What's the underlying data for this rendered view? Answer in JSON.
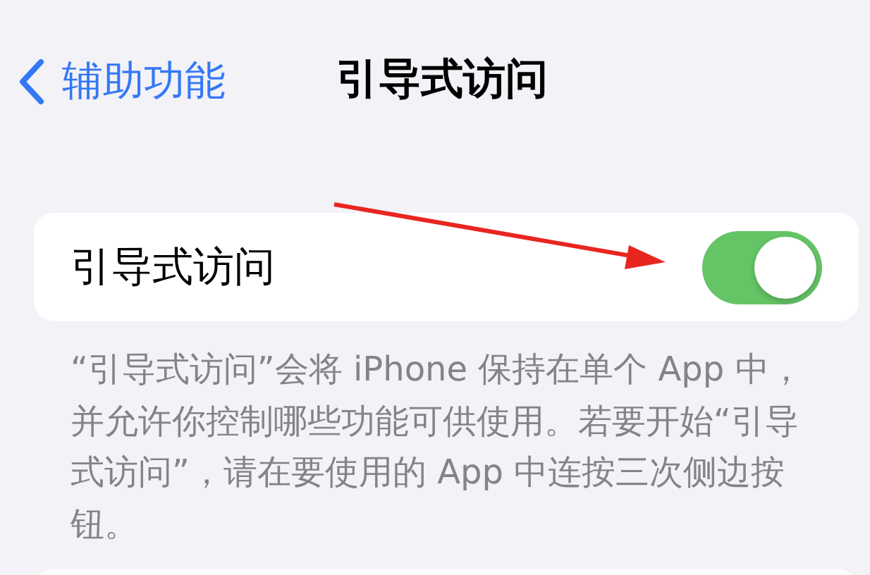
{
  "nav": {
    "back_label": "辅助功能",
    "title": "引导式访问"
  },
  "setting": {
    "label": "引导式访问",
    "on": true
  },
  "footer": "“引导式访问”会将 iPhone 保持在单个 App 中，并允许你控制哪些功能可供使用。若要开始“引导式访问”，请在要使用的 App 中连按三次侧边按钮。"
}
